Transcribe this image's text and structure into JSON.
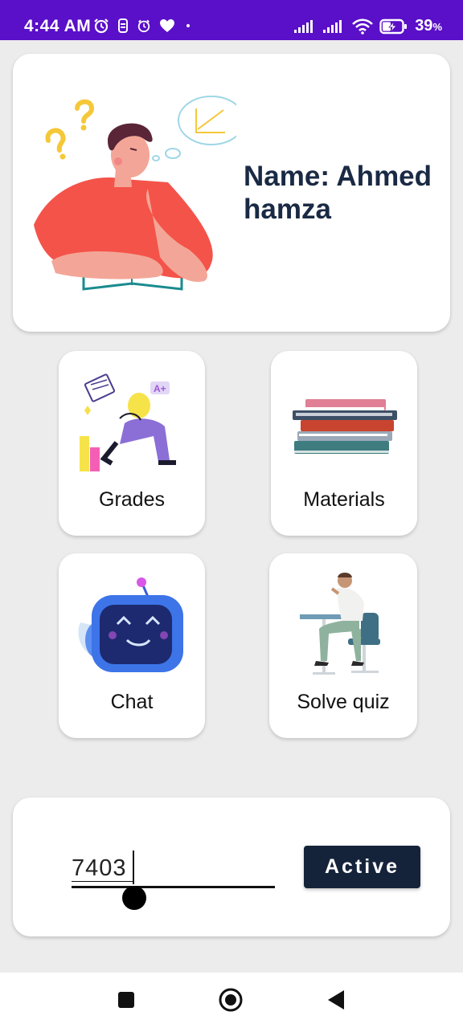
{
  "status_bar": {
    "time": "4:44 AM",
    "battery_pct": "39",
    "battery_unit": "%",
    "left_icons": [
      "alarm-clock-icon",
      "vpn-icon",
      "alarm-icon",
      "heart-icon",
      "dot-icon"
    ],
    "right_icons": [
      "signal-icon",
      "signal-icon",
      "wifi-icon",
      "battery-charging-icon"
    ],
    "bg_color": "#5a0fc8"
  },
  "profile": {
    "name": "Name: Ahmed hamza",
    "illustration": "thinking-student-illustration"
  },
  "tiles": [
    {
      "label": "Grades",
      "illustration": "grades-illustration"
    },
    {
      "label": "Materials",
      "illustration": "books-stack-illustration"
    },
    {
      "label": "Chat",
      "illustration": "robot-chat-illustration"
    },
    {
      "label": "Solve quiz",
      "illustration": "student-desk-illustration"
    }
  ],
  "activation": {
    "code_value": "7403",
    "button_label": "Active"
  },
  "nav_bar": {
    "buttons": [
      "recents-square-icon",
      "home-circle-icon",
      "back-triangle-icon"
    ]
  },
  "colors": {
    "title_text": "#1a2a44",
    "button_bg": "#15233a",
    "background": "#ececec"
  }
}
